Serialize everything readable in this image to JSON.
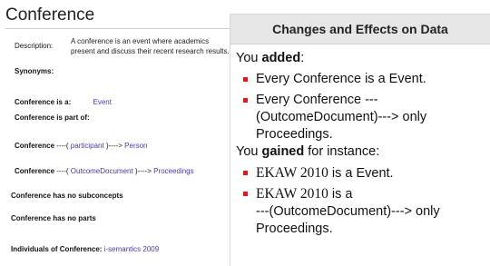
{
  "concept": {
    "title": "Conference",
    "description_label": "Description:",
    "description_text": "A conference is an event where academics present and discuss their recent research results.",
    "synonyms_label": "Synonyms:",
    "is_a_label": "Conference is a:",
    "is_a_value": "Event",
    "part_of_label": "Conference is part of:",
    "rel1": {
      "subject": "Conference",
      "pre": "----( ",
      "property": "participant",
      "post": " )----> ",
      "target": "Person"
    },
    "rel2": {
      "subject": "Conference",
      "pre": "----( ",
      "property": "OutcomeDocument",
      "post": " )----> ",
      "target": "Proceedings"
    },
    "no_subconcepts": "Conference has no subconcepts",
    "no_parts": "Conference has no parts",
    "individuals_label": "Individuals of Conference:",
    "individuals_value": "i-semantics 2009"
  },
  "panel": {
    "header": "Changes and Effects on Data",
    "added_pre": "You ",
    "added_bold": "added",
    "added_post": ":",
    "added_items": [
      [
        "Every Conference is a Event."
      ],
      [
        "Every Conference ---",
        "(OutcomeDocument)---> only",
        "Proceedings."
      ]
    ],
    "gained_pre": "You ",
    "gained_bold": "gained",
    "gained_post": " for instance:",
    "gained_1_serif": "EKAW 2010",
    "gained_1_rest": " is a Event.",
    "gained_2_serif": "EKAW 2010",
    "gained_2_rest": " is a",
    "gained_2_line2": "---(OutcomeDocument)---> only",
    "gained_2_line3": "Proceedings."
  },
  "colors": {
    "link": "#4a3aa8",
    "bullet": "#e8161b",
    "header_bg": "#e6e6e6"
  }
}
